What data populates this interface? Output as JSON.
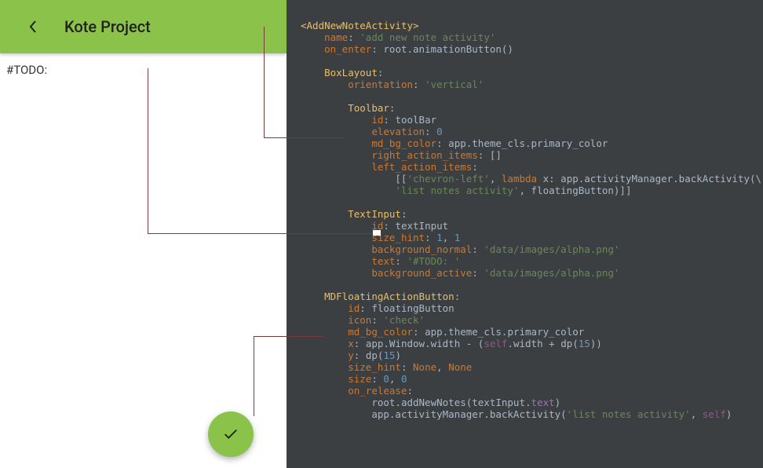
{
  "app": {
    "toolbar_title": "Kote Project",
    "todo_text": "#TODO:"
  },
  "icons": {
    "back": "chevron-left",
    "fab": "check"
  },
  "colors": {
    "primary": "#8bc34a",
    "code_bg": "#3c3f41"
  },
  "code": {
    "root_tag_open": "<",
    "root_tag_name": "AddNewNoteActivity",
    "root_tag_close": ">",
    "name_key": "name",
    "name_val": "'add new note activity'",
    "on_enter_key": "on_enter",
    "root_ref": "root",
    "animation_call": ".animationButton()",
    "boxlayout": "BoxLayout",
    "orientation_key": "orientation",
    "orientation_val": "'vertical'",
    "toolbar": "Toolbar",
    "id_key": "id",
    "toolbar_id": "toolBar",
    "elevation_key": "elevation",
    "elevation_val": "0",
    "md_bg_key": "md_bg_color",
    "app_ref": "app",
    "theme_path": ".theme_cls.primary_color",
    "right_actions_key": "right_action_items",
    "right_actions_val": "[]",
    "left_actions_key": "left_action_items",
    "chevron_str": "'chevron-left'",
    "lambda_kw": "lambda",
    "lambda_x": "x",
    "activity_mgr": ".activityManager.backActivity(\\",
    "list_notes_str": "'list notes activity'",
    "floating_ref": "floatingButton)]]",
    "textinput": "TextInput",
    "textinput_id": "textInput",
    "size_hint_key": "size_hint",
    "one": "1",
    "bg_normal_key": "background_normal",
    "alpha_png": "'data/images/alpha.png'",
    "text_key": "text",
    "todo_str": "'#TODO: '",
    "bg_active_key": "background_active",
    "mdfab": "MDFloatingActionButton",
    "fab_id": "floatingButton",
    "icon_key": "icon",
    "icon_val": "'check'",
    "x_key": "x",
    "window_width": ".Window.width",
    "self_ref": "self",
    "self_width": ".width",
    "dp_call": "dp(",
    "fifteen": "15",
    "y_key": "y",
    "none_val": "None",
    "size_key": "size",
    "zero": "0",
    "on_release_key": "on_release",
    "add_notes": ".addNewNotes(textInput.",
    "text_prop": "text",
    "activity_back2": ".activityManager.backActivity(",
    "minus": " - (",
    "plus": " + "
  }
}
